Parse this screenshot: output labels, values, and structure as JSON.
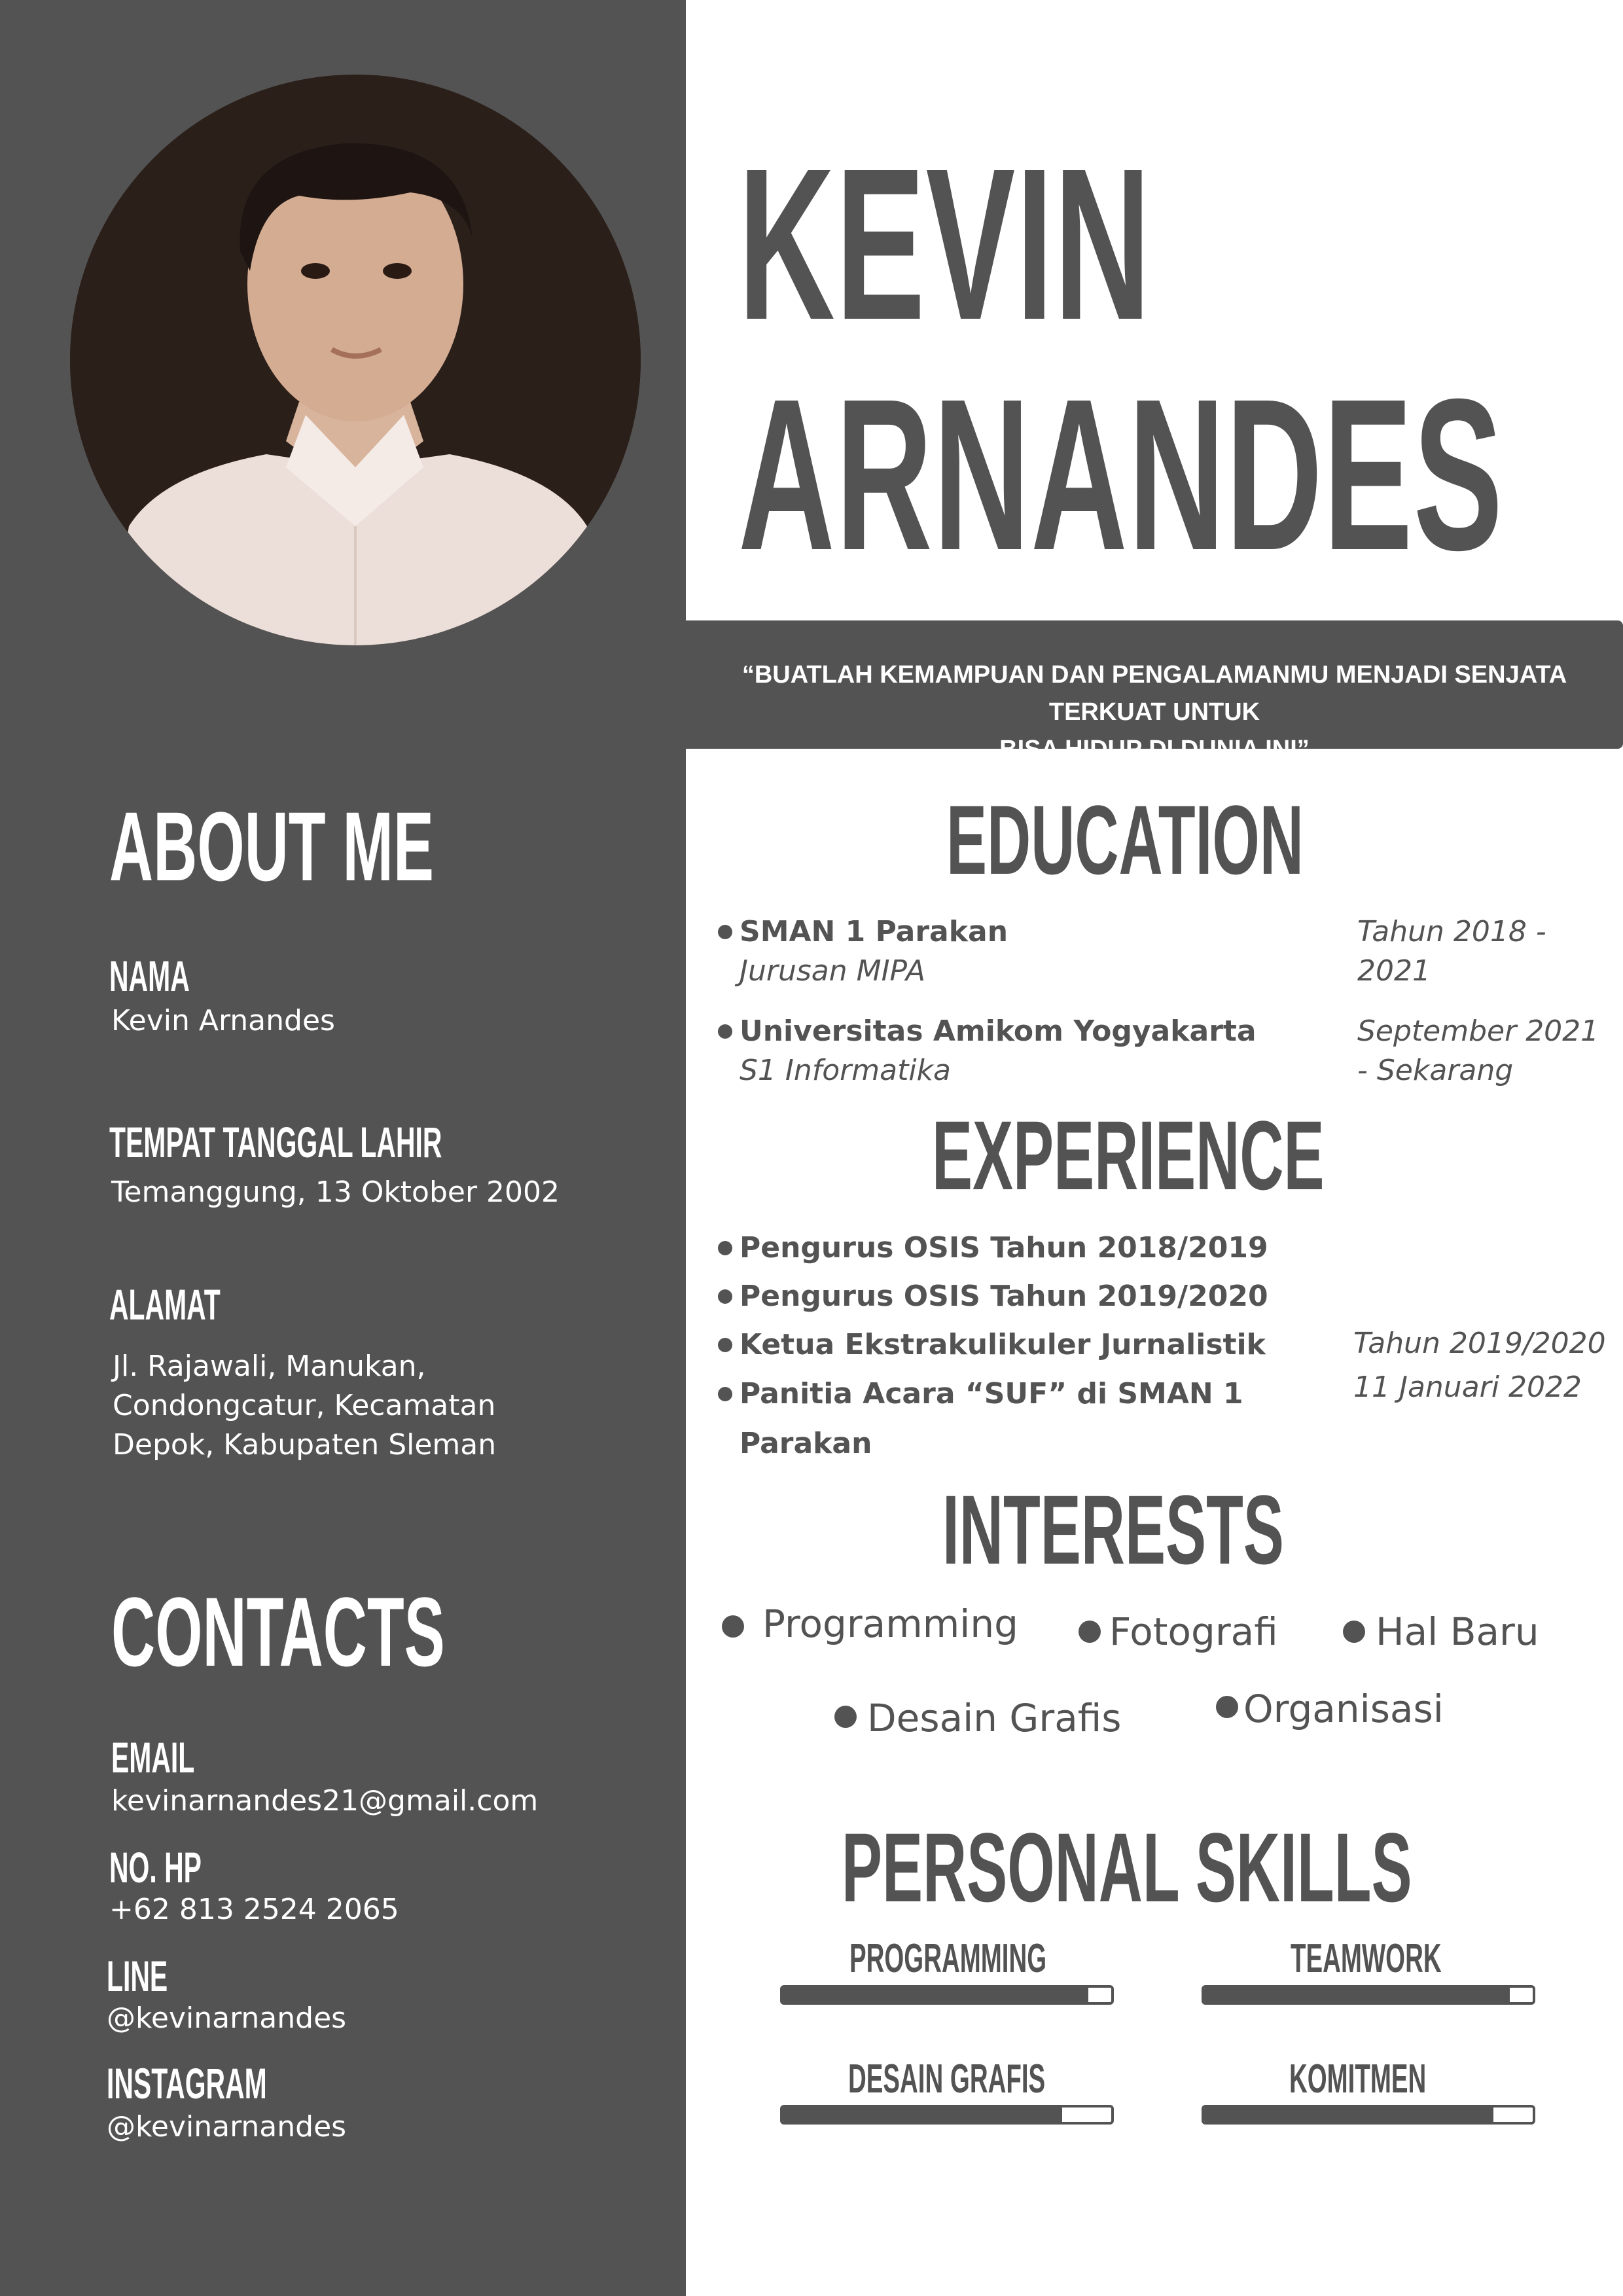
{
  "name": {
    "first": "KEVIN",
    "last": "ARNANDES"
  },
  "quote": {
    "line1": "“BUATLAH KEMAMPUAN DAN PENGALAMANMU MENJADI SENJATA TERKUAT UNTUK",
    "line2": "BISA HIDUP DI DUNIA INI”"
  },
  "about": {
    "title": "ABOUT ME",
    "nama_label": "NAMA",
    "nama_value": "Kevin Arnandes",
    "ttl_label": "TEMPAT TANGGAL LAHIR",
    "ttl_value": "Temanggung, 13 Oktober 2002",
    "alamat_label": "ALAMAT",
    "alamat_lines": [
      "Jl. Rajawali, Manukan,",
      "Condongcatur, Kecamatan",
      "Depok, Kabupaten Sleman"
    ]
  },
  "contacts": {
    "title": "CONTACTS",
    "email_label": "EMAIL",
    "email_value": "kevinarnandes21@gmail.com",
    "hp_label": "NO. HP",
    "hp_value": "+62 813 2524 2065",
    "line_label": "LINE",
    "line_value": "@kevinarnandes",
    "instagram_label": "INSTAGRAM",
    "instagram_value": "@kevinarnandes"
  },
  "education": {
    "title": "EDUCATION",
    "items": [
      {
        "school": "SMAN 1 Parakan",
        "detail": "Jurusan MIPA",
        "period_lines": [
          "Tahun 2018 -",
          "2021"
        ]
      },
      {
        "school": "Universitas Amikom Yogyakarta",
        "detail": "S1 Informatika",
        "period_lines": [
          "September 2021",
          "- Sekarang"
        ]
      }
    ]
  },
  "experience": {
    "title": "EXPERIENCE",
    "items": [
      "Pengurus OSIS Tahun 2018/2019",
      "Pengurus OSIS Tahun 2019/2020",
      "Ketua Ekstrakulikuler Jurnalistik",
      "Panitia Acara “SUF” di SMAN 1"
    ],
    "item4_cont": "Parakan",
    "dates": [
      "Tahun 2019/2020",
      "11 Januari 2022"
    ]
  },
  "interests": {
    "title": "INTERESTS",
    "items": [
      "Programming",
      "Fotografi",
      "Hal Baru",
      "Desain Grafis",
      "Organisasi"
    ]
  },
  "skills": {
    "title": "PERSONAL SKILLS",
    "items": [
      {
        "label": "PROGRAMMING",
        "level": 0.93
      },
      {
        "label": "TEAMWORK",
        "level": 0.93
      },
      {
        "label": "DESAIN GRAFIS",
        "level": 0.85
      },
      {
        "label": "KOMITMEN",
        "level": 0.88
      }
    ]
  }
}
